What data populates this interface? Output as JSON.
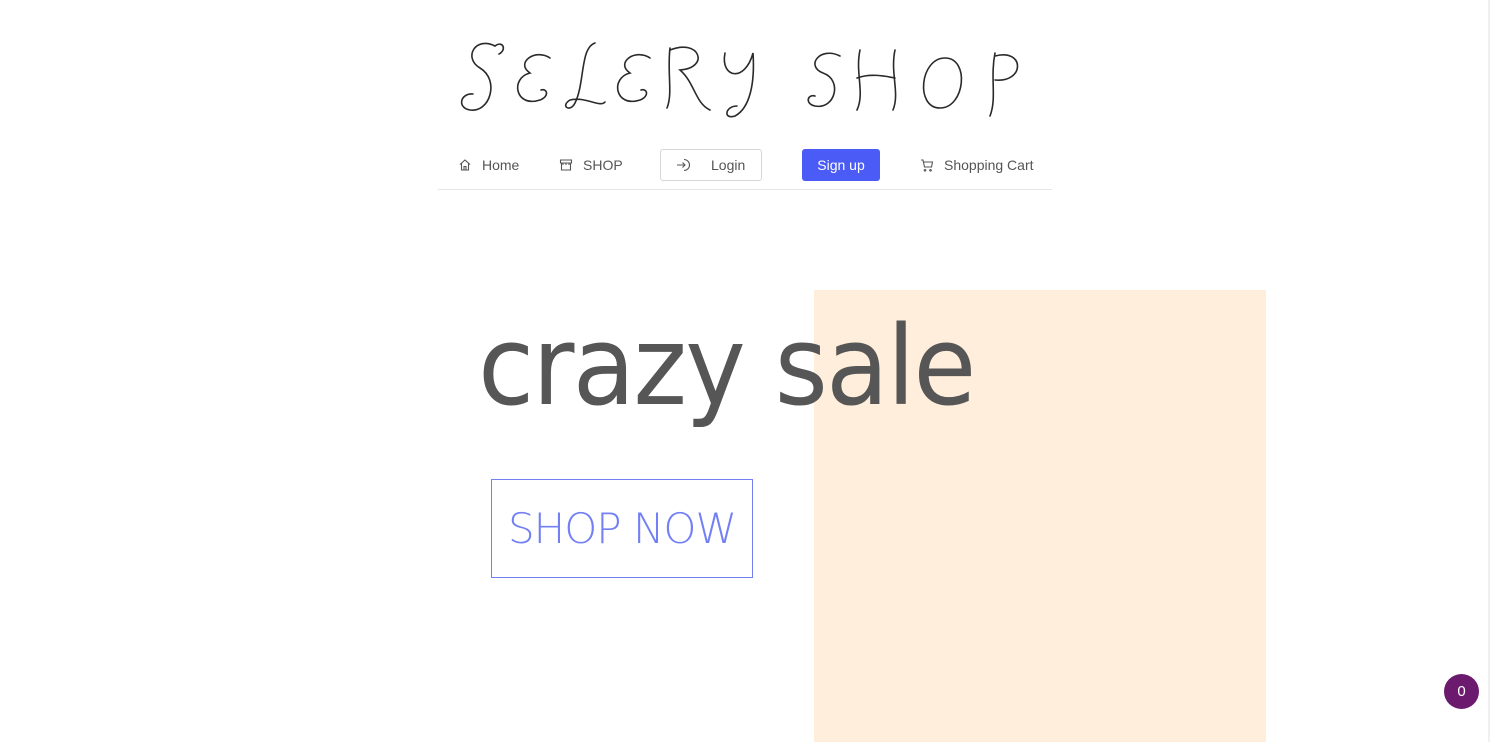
{
  "logo": {
    "text": "SELERY SHOP"
  },
  "nav": {
    "home_label": "Home",
    "shop_label": "SHOP",
    "login_label": "Login",
    "signup_label": "Sign up",
    "cart_label": "Shopping Cart"
  },
  "hero": {
    "title": "crazy sale",
    "cta_label": "SHOP NOW"
  },
  "floating_badge": {
    "count": "0"
  },
  "colors": {
    "accent": "#4a5cf5",
    "cta_outline": "#7380f5",
    "hero_block": "#feeedb",
    "title_text": "#565656",
    "badge": "#6b1a6e"
  },
  "icons": {
    "home": "home-icon",
    "shop": "shop-icon",
    "login": "login-icon",
    "cart": "cart-icon"
  }
}
